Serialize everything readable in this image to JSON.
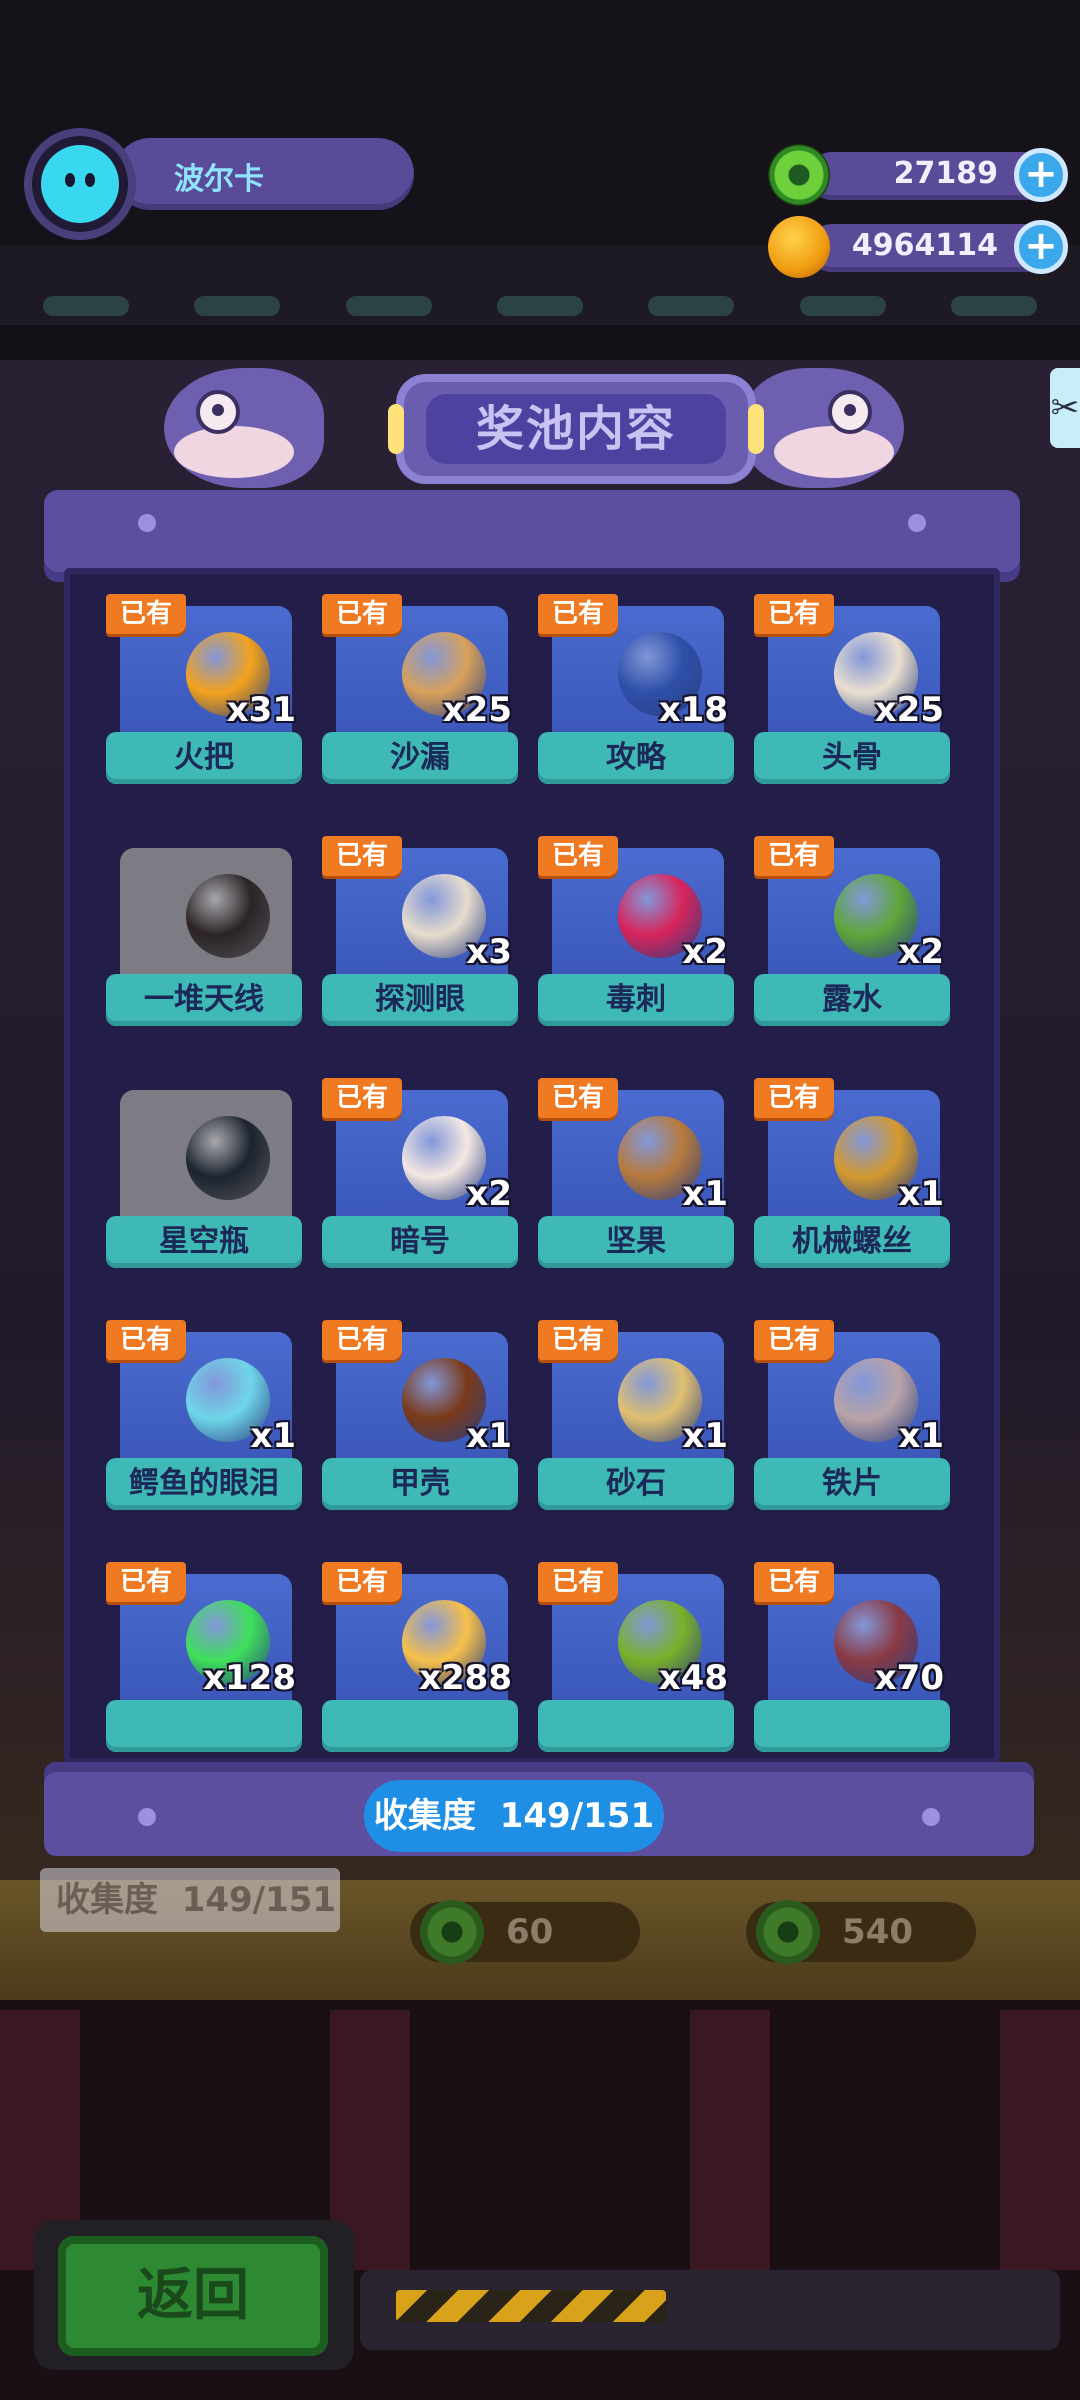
{
  "profile": {
    "name": "波尔卡",
    "avatar_icon": "cat-face-icon"
  },
  "currency": [
    {
      "icon": "donut-coin-icon",
      "value": "27189",
      "plus": "+"
    },
    {
      "icon": "planet-coin-icon",
      "value": "4964114",
      "plus": "+"
    }
  ],
  "panel": {
    "title": "奖池内容",
    "owned_badge": "已有",
    "items": [
      {
        "name": "火把",
        "count": "x31",
        "owned": true,
        "icon": "torch-icon",
        "color": "#f3a21c"
      },
      {
        "name": "沙漏",
        "count": "x25",
        "owned": true,
        "icon": "hourglass-icon",
        "color": "#d8a15a"
      },
      {
        "name": "攻略",
        "count": "x18",
        "owned": true,
        "icon": "book-icon",
        "color": "#2e4fa8"
      },
      {
        "name": "头骨",
        "count": "x25",
        "owned": true,
        "icon": "skull-icon",
        "color": "#eadfcf"
      },
      {
        "name": "一堆天线",
        "count": "",
        "owned": false,
        "icon": "antenna-icon",
        "color": "#2b2326"
      },
      {
        "name": "探测眼",
        "count": "x3",
        "owned": true,
        "icon": "eye-icon",
        "color": "#e7dccd"
      },
      {
        "name": "毒刺",
        "count": "x2",
        "owned": true,
        "icon": "stinger-icon",
        "color": "#d8245a"
      },
      {
        "name": "露水",
        "count": "x2",
        "owned": true,
        "icon": "dew-leaf-icon",
        "color": "#5fa63a"
      },
      {
        "name": "星空瓶",
        "count": "",
        "owned": false,
        "icon": "star-jar-icon",
        "color": "#1c2430"
      },
      {
        "name": "暗号",
        "count": "x2",
        "owned": true,
        "icon": "paper-note-icon",
        "color": "#f4e8e2"
      },
      {
        "name": "坚果",
        "count": "x1",
        "owned": true,
        "icon": "nut-icon",
        "color": "#b77a3c"
      },
      {
        "name": "机械螺丝",
        "count": "x1",
        "owned": true,
        "icon": "screw-icon",
        "color": "#d49a2e"
      },
      {
        "name": "鳄鱼的眼泪",
        "count": "x1",
        "owned": true,
        "icon": "crocodile-tear-icon",
        "color": "#6fd6e8"
      },
      {
        "name": "甲壳",
        "count": "x1",
        "owned": true,
        "icon": "shell-icon",
        "color": "#7a3a1a"
      },
      {
        "name": "砂石",
        "count": "x1",
        "owned": true,
        "icon": "sandstone-icon",
        "color": "#e0c070"
      },
      {
        "name": "铁片",
        "count": "x1",
        "owned": true,
        "icon": "iron-plate-icon",
        "color": "#b8a3a8"
      },
      {
        "name": "",
        "count": "x128",
        "owned": true,
        "icon": "potion-icon",
        "color": "#3ee05a"
      },
      {
        "name": "",
        "count": "x288",
        "owned": true,
        "icon": "lamp-icon",
        "color": "#f6c04a"
      },
      {
        "name": "",
        "count": "x48",
        "owned": true,
        "icon": "branch-icon",
        "color": "#7bb02a"
      },
      {
        "name": "",
        "count": "x70",
        "owned": true,
        "icon": "coil-icon",
        "color": "#8a3a44"
      }
    ],
    "collection_label": "收集度",
    "collection_value": "149/151"
  },
  "background": {
    "collection_label": "收集度",
    "collection_value": "149/151",
    "price_left": "60",
    "price_right": "540"
  },
  "back_button": "返回",
  "side_tab_icon": "scissors-icon"
}
